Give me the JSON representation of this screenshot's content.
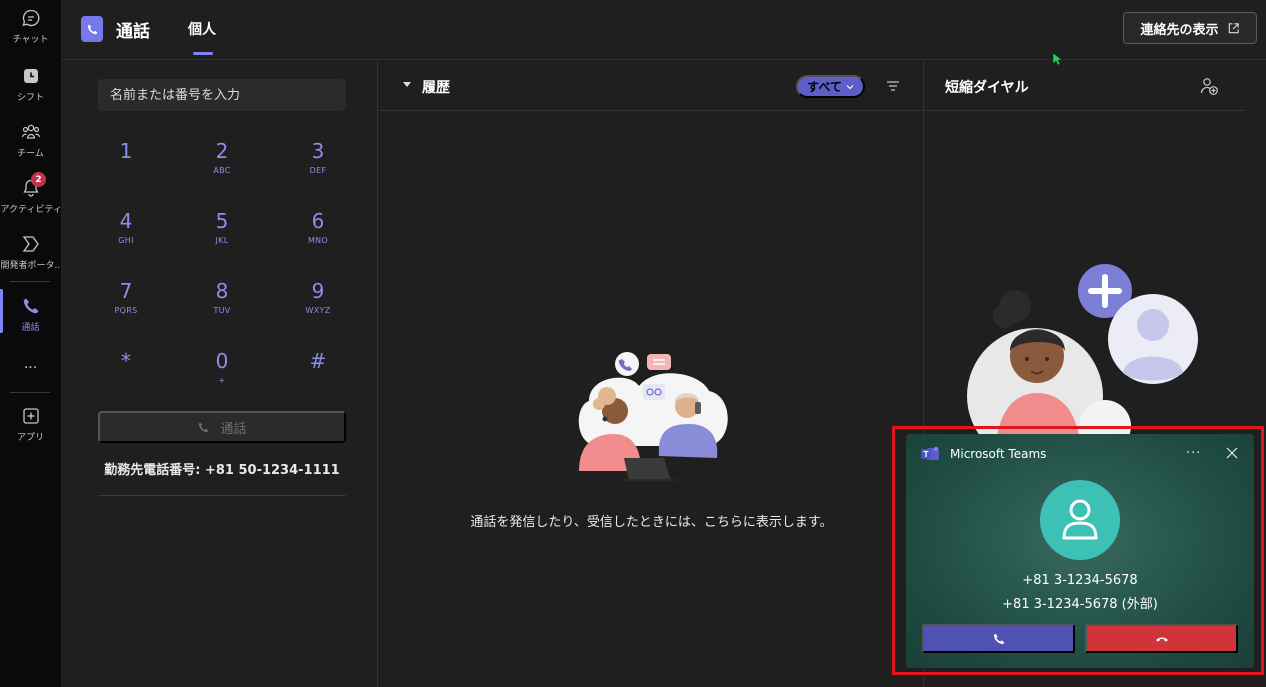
{
  "rail": {
    "items": [
      {
        "label": "チャット",
        "icon": "chat-icon"
      },
      {
        "label": "シフト",
        "icon": "shifts-icon"
      },
      {
        "label": "チーム",
        "icon": "teams-icon"
      },
      {
        "label": "アクティビティ",
        "icon": "bell-icon",
        "badge": "2"
      },
      {
        "label": "開発者ポータ...",
        "icon": "developer-portal-icon"
      },
      {
        "label": "通話",
        "icon": "phone-icon"
      },
      {
        "label": "...",
        "icon": "more-icon"
      },
      {
        "label": "アプリ",
        "icon": "apps-icon"
      }
    ]
  },
  "header": {
    "title": "通話",
    "tab": "個人",
    "contacts_button": "連絡先の表示"
  },
  "dialpad": {
    "placeholder": "名前または番号を入力",
    "keys": [
      {
        "digit": "1",
        "letters": ""
      },
      {
        "digit": "2",
        "letters": "ABC"
      },
      {
        "digit": "3",
        "letters": "DEF"
      },
      {
        "digit": "4",
        "letters": "GHI"
      },
      {
        "digit": "5",
        "letters": "JKL"
      },
      {
        "digit": "6",
        "letters": "MNO"
      },
      {
        "digit": "7",
        "letters": "PQRS"
      },
      {
        "digit": "8",
        "letters": "TUV"
      },
      {
        "digit": "9",
        "letters": "WXYZ"
      },
      {
        "digit": "*",
        "letters": ""
      },
      {
        "digit": "0",
        "letters": "+"
      },
      {
        "digit": "#",
        "letters": ""
      }
    ],
    "call_button": "通話",
    "work_number": "勤務先電話番号: +81 50-1234-1111"
  },
  "history": {
    "title": "履歴",
    "filter": "すべて",
    "empty_message": "通話を発信したり、受信したときには、こちらに表示します。"
  },
  "speed_dial": {
    "title": "短縮ダイヤル"
  },
  "toast": {
    "app_name": "Microsoft Teams",
    "more": "···",
    "caller_line1": "+81 3-1234-5678",
    "caller_line2": "+81 3-1234-5678 (外部)"
  },
  "colors": {
    "accent": "#7f85f5",
    "accept": "#4f52b2",
    "decline": "#d13438",
    "highlight_frame": "#e0161e"
  }
}
